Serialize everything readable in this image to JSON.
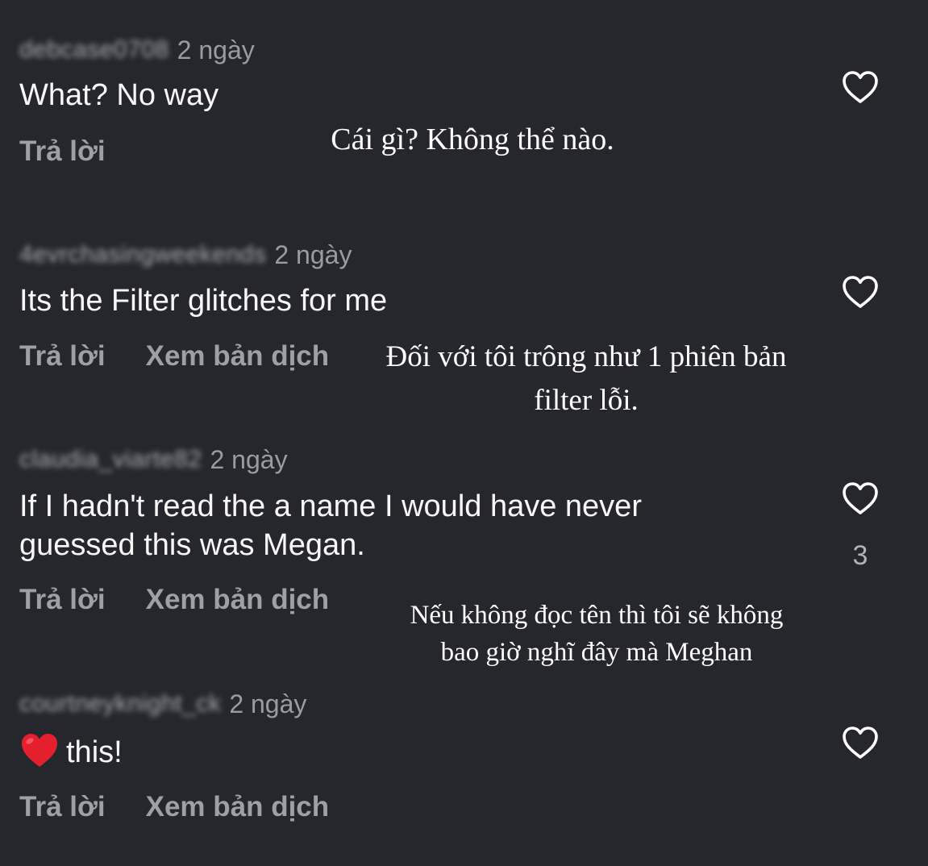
{
  "comments": [
    {
      "username": "debcase0708",
      "time": "2 ngày",
      "text": "What? No way",
      "actions": {
        "reply": "Trả lời"
      },
      "translation": [
        "Cái gì? Không thể nào."
      ]
    },
    {
      "username": "4evrchasingweekends",
      "time": "2 ngày",
      "text": "Its the Filter glitches for me",
      "actions": {
        "reply": "Trả lời",
        "translate": "Xem bản dịch"
      },
      "translation": [
        "Đối với tôi trông như 1 phiên bản",
        "filter lỗi."
      ]
    },
    {
      "username": "claudia_viarte82",
      "time": "2 ngày",
      "text_lines": [
        "If I hadn't read the a name I would have never",
        "guessed this was Megan."
      ],
      "actions": {
        "reply": "Trả lời",
        "translate": "Xem bản dịch"
      },
      "likes": "3",
      "translation": [
        "Nếu không đọc tên thì tôi sẽ không",
        "bao giờ nghĩ đây mà Meghan"
      ]
    },
    {
      "username": "courtneyknight_ck",
      "time": "2 ngày",
      "text": "this!",
      "emoji": "red-heart",
      "actions": {
        "reply": "Trả lời",
        "translate": "Xem bản dịch"
      }
    }
  ],
  "colors": {
    "background": "#25272d",
    "text": "#f7f7f8",
    "secondary": "#9ea0a7",
    "heart_emoji": "#e5202e"
  },
  "icons": {
    "like": "heart-outline-icon",
    "emoji": "red-heart-icon"
  }
}
